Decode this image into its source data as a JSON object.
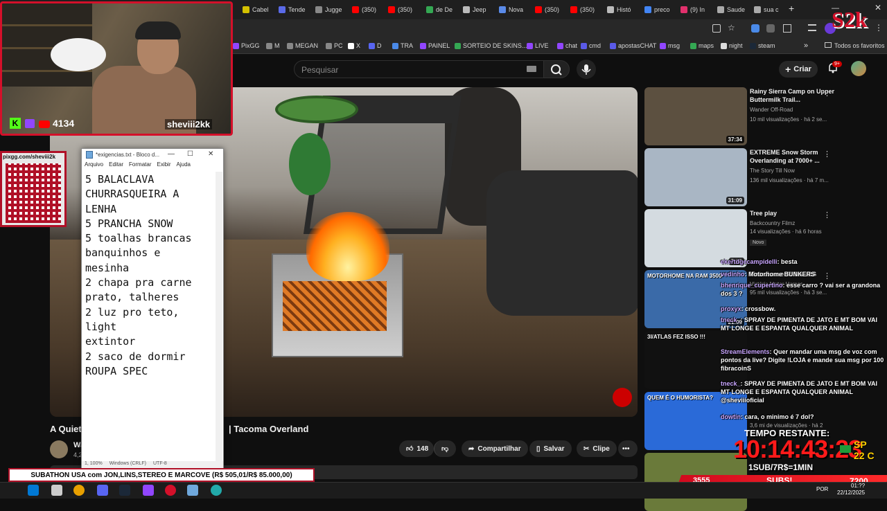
{
  "browser": {
    "tabs": [
      {
        "label": "Cabel",
        "color": "#d4c100"
      },
      {
        "label": "Tende",
        "color": "#5a6ae8"
      },
      {
        "label": "Jugge",
        "color": "#888888"
      },
      {
        "label": "(350)",
        "color": "#ff0000"
      },
      {
        "label": "(350)",
        "color": "#ff0000"
      },
      {
        "label": "de De",
        "color": "#34a853"
      },
      {
        "label": "Jeep",
        "color": "#bbbbbb"
      },
      {
        "label": "Nova",
        "color": "#5a8ae8"
      },
      {
        "label": "(350)",
        "color": "#ff0000"
      },
      {
        "label": "(350)",
        "color": "#ff0000"
      },
      {
        "label": "Histó",
        "color": "#bbbbbb"
      },
      {
        "label": "preco",
        "color": "#4285f4"
      },
      {
        "label": "(9) In",
        "color": "#e1306c"
      },
      {
        "label": "Saude",
        "color": "#aaaaaa"
      },
      {
        "label": "sua c",
        "color": "#aaaaaa"
      }
    ],
    "new_tab": "+",
    "bookmarks": [
      {
        "label": "PixGG",
        "color": "#9146ff"
      },
      {
        "label": "M",
        "color": "#888888"
      },
      {
        "label": "MEGAN",
        "color": "#888888"
      },
      {
        "label": "PC",
        "color": "#888888"
      },
      {
        "label": "X",
        "color": "#ffffff"
      },
      {
        "label": "D",
        "color": "#5865f2"
      },
      {
        "label": "TRA",
        "color": "#4a8ae8"
      },
      {
        "label": "PAINEL",
        "color": "#9146ff"
      },
      {
        "label": "SORTEIO DE SKINS...",
        "color": "#34a853"
      },
      {
        "label": "LIVE",
        "color": "#9146ff"
      },
      {
        "label": "chat",
        "color": "#9146ff"
      },
      {
        "label": "cmd",
        "color": "#5a5ae8"
      },
      {
        "label": "apostasCHAT",
        "color": "#5a5ae8"
      },
      {
        "label": "msg",
        "color": "#9146ff"
      },
      {
        "label": "maps",
        "color": "#34a853"
      },
      {
        "label": "night",
        "color": "#dddddd"
      },
      {
        "label": "steam",
        "color": "#1b2838"
      }
    ],
    "bookmarks_more": "»",
    "all_favorites": "Todos os favoritos"
  },
  "youtube": {
    "search_placeholder": "Pesquisar",
    "create_label": "Criar",
    "notif_count": "9+",
    "video_title_left": "A Quiet",
    "video_title_right": "| Tacoma Overland",
    "channel_initial": "Wa",
    "channel_subs": "4,2",
    "likes": "148",
    "share_label": "Compartilhar",
    "save_label": "Salvar",
    "clip_label": "Clipe",
    "more_label": "•••"
  },
  "recommendations": [
    {
      "title": "Rainy Sierra Camp on Upper Buttermilk Trail...",
      "channel": "Wander Off-Road",
      "meta": "10 mil visualizações · há 2 se...",
      "duration": "37:34",
      "thumb": "#5c5040"
    },
    {
      "title": "EXTREME Snow Storm Overlanding at 7000+ ...",
      "channel": "The Story Till Now",
      "meta": "136 mil visualizações · há 7 m...",
      "duration": "31:09",
      "thumb": "#a9b6c4"
    },
    {
      "title": "Tree play",
      "channel": "Backcountry Filmz",
      "meta": "14 visualizações · há 6 horas",
      "duration": "7:26",
      "thumb": "#d4dbe0",
      "badge": "Novo"
    },
    {
      "title": "Motorhome BUNKERS",
      "channel": "Victória Motor Homes",
      "meta": "95 mil visualizações · há 3 se...",
      "duration": "21:09",
      "thumb": "#3a6aa8",
      "thumb_text": "MOTORHOME NA RAM 3500"
    },
    {
      "title": "",
      "channel": "",
      "meta": "",
      "duration": "",
      "thumb": "#111111",
      "thumb_text": "3I/ATLAS FEZ ISSO !!!"
    },
    {
      "title": "",
      "channel": "",
      "meta": "3,6 mi de visualizações · há 2",
      "duration": "",
      "thumb": "#2a6ad8",
      "thumb_text": "QUEM É O HUMORISTA?"
    },
    {
      "title": "",
      "channel": "",
      "meta": "",
      "duration": "",
      "thumb": "#6a7a3a"
    }
  ],
  "webcam": {
    "viewers": "4134",
    "handle": "sheviii2kk",
    "kick_letter": "K"
  },
  "qr": {
    "url": "pixgg.com/sheviii2k"
  },
  "notepad": {
    "title": "*exigencias.txt - Bloco d...",
    "menu": [
      "Arquivo",
      "Editar",
      "Formatar",
      "Exibir",
      "Ajuda"
    ],
    "content": "5 BALACLAVA\nCHURRASQUEIRA A\nLENHA\n5 PRANCHA SNOW\n5 toalhas brancas\nbanquinhos e\nmesinha\n2 chapa pra carne\nprato, talheres\n2 luz pro teto,\nlight\nextintor\n2 saco de dormir\nROUPA SPEC",
    "status": [
      "1, 100%",
      "Windows (CRLF)",
      "UTF-8"
    ],
    "controls": [
      "—",
      "☐",
      "✕"
    ]
  },
  "chat": [
    {
      "user": "ekertdgecampidelli",
      "text": ": besta"
    },
    {
      "user": "vedinho",
      "text": ": Motorhome BUNKERS"
    },
    {
      "user": "bhenrique_cupertino",
      "text": ": esse carro ? vai ser a grandona dos 3 ?"
    },
    {
      "user": "proxyx",
      "text": ": crossbow."
    },
    {
      "user": "tneck_",
      "text": ": SPRAY DE PIMENTA DE JATO E MT BOM VAI MT LONGE E ESPANTA QUALQUER ANIMAL"
    },
    {
      "user": "StreamElements",
      "text": ": Quer mandar uma msg de voz com pontos da live? Digite !LOJA e mande sua msg por 100 fibracoinS"
    },
    {
      "user": "tneck_",
      "text": ": SPRAY DE PIMENTA DE JATO E MT BOM VAI MT LONGE E ESPANTA QUALQUER ANIMAL @sheviiioficial"
    },
    {
      "user": "dowtin",
      "text": ": cara, o minimo é 7 dol?"
    }
  ],
  "overlay": {
    "subathon": "SUBATHON USA com JON,LINS,STEREO E MARCOVE (R$ 505,01/R$ 85.000,00)",
    "timer_label": "TEMPO RESTANTE:",
    "timer": "10:14:43:23",
    "location": "SP",
    "temperature": "22 C",
    "sub_rate": "1SUB/7R$=1MIN",
    "bottom_left": "3555",
    "bottom_mid": "SUBS!",
    "bottom_right": "7200",
    "logo": "S2k"
  },
  "taskbar": {
    "lang": "POR",
    "time": "01:??",
    "date": "22/12/2025"
  }
}
